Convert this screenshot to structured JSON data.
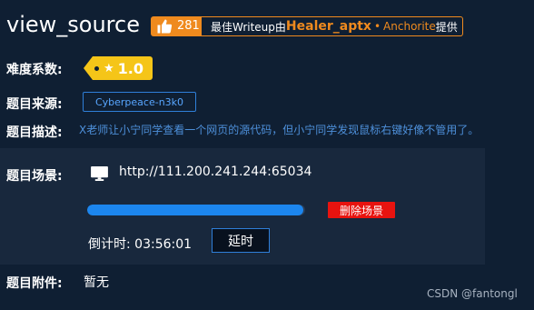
{
  "challenge": {
    "title": "view_source",
    "likes": "281",
    "writeup_prefix": "最佳Writeup由",
    "writeup_author": "Healer_aptx",
    "writeup_sep": "•",
    "writeup_org": "Anchorite",
    "writeup_suffix": "提供"
  },
  "difficulty": {
    "label": "难度系数:",
    "value": "1.0"
  },
  "source": {
    "label": "题目来源:",
    "tag": "Cyberpeace-n3k0"
  },
  "description": {
    "label": "题目描述:",
    "text": "X老师让小宁同学查看一个网页的源代码，但小宁同学发现鼠标右键好像不管用了。"
  },
  "scene": {
    "label": "题目场景:",
    "url": "http://111.200.241.244:65034",
    "progress": 0.99,
    "delete_label": "删除场景",
    "countdown_label": "倒计时:",
    "countdown_value": "03:56:01",
    "extend_label": "延时"
  },
  "attachment": {
    "label": "题目附件:",
    "value": "暂无"
  },
  "watermark": "CSDN @fantongl",
  "colors": {
    "background": "#0f1f33",
    "panel": "#18283d",
    "accent_orange": "#ef8a1e",
    "accent_blue": "#1c86ee",
    "difficulty_yellow": "#f5c518",
    "danger_red": "#e8130f"
  },
  "icons": {
    "like": "thumbs-up-icon",
    "star": "star-icon",
    "monitor": "monitor-icon"
  }
}
